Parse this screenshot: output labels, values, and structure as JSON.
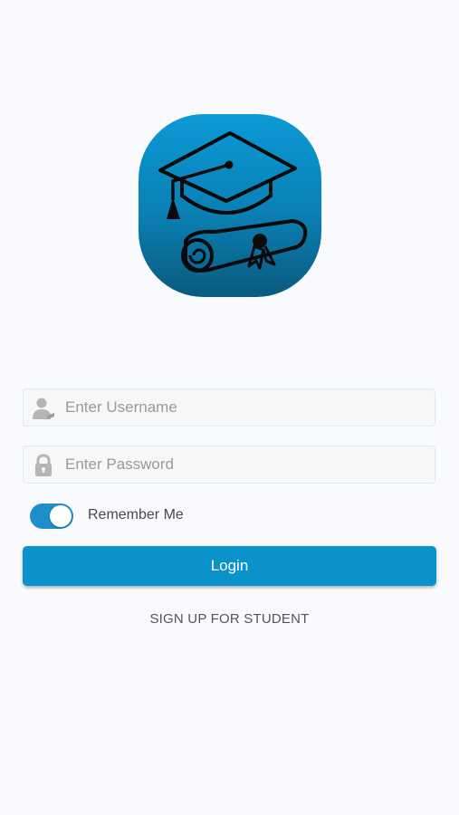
{
  "app": {
    "logo_icon": "graduation-cap-diploma-icon",
    "colors": {
      "primary": "#0a93cb",
      "toggle_on": "#1e8fc9",
      "background": "#f8fafd"
    }
  },
  "form": {
    "username": {
      "icon": "user-icon",
      "value": "",
      "placeholder": "Enter Username"
    },
    "password": {
      "icon": "lock-icon",
      "value": "",
      "placeholder": "Enter Password"
    },
    "remember_me": {
      "label": "Remember Me",
      "checked": true
    },
    "login_label": "Login",
    "signup_label": "SIGN UP FOR STUDENT"
  }
}
